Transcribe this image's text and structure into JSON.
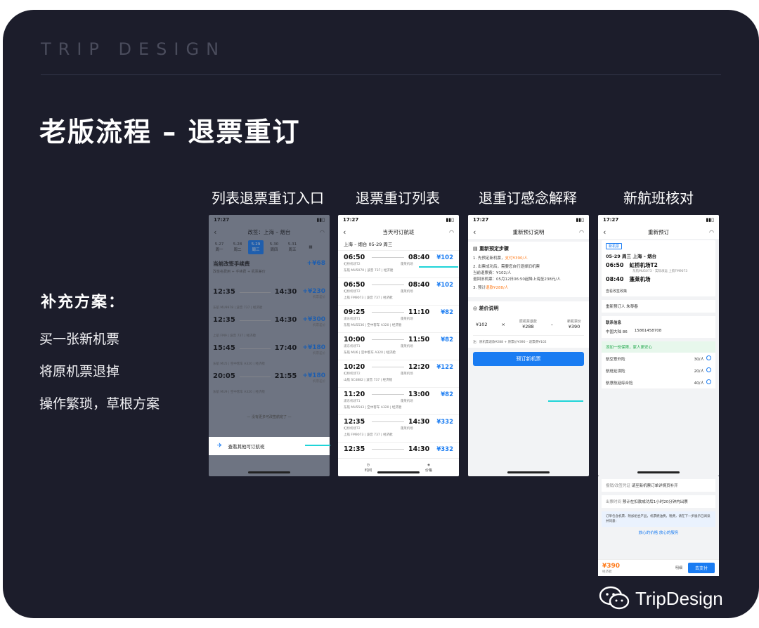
{
  "brand": "TRIP DESIGN",
  "title": "老版流程 – 退票重订",
  "supplement": {
    "title": "补充方案：",
    "items": [
      "买一张新机票",
      "将原机票退掉",
      "操作繁琐，草根方案"
    ]
  },
  "columns": [
    "列表退票重订入口",
    "退票重订列表",
    "退重订感念解释",
    "新航班核对"
  ],
  "status_time": "17:27",
  "phone1": {
    "nav_title": "改签：上海 – 烟台",
    "dates": [
      {
        "d": "5-27",
        "w": "周一"
      },
      {
        "d": "5-28",
        "w": "周二"
      },
      {
        "d": "5-29",
        "w": "周三"
      },
      {
        "d": "5-30",
        "w": "周四"
      },
      {
        "d": "5-31",
        "w": "周五"
      }
    ],
    "fee_title": "当前改签手续费",
    "fee_price": "+¥68",
    "fee_sub": "改签名费用 + 手续费 + 机票差价",
    "flights": [
      {
        "dep": "12:35",
        "arr": "14:30",
        "price": "+¥230",
        "note": "机票差价",
        "air": "东航 MU9978 | 波音 737 | 经济舱"
      },
      {
        "dep": "12:35",
        "arr": "14:30",
        "price": "+¥300",
        "note": "机票差价",
        "air": "上航 FM9 | 波音 737 | 经济舱"
      },
      {
        "dep": "15:45",
        "arr": "17:40",
        "price": "+¥180",
        "note": "机票差价",
        "air": "东航 MU5 | 空中客车 A320 | 经济舱"
      },
      {
        "dep": "20:05",
        "arr": "21:55",
        "price": "+¥180",
        "note": "机票差价",
        "air": "东航 MU9 | 空中客车 A320 | 经济舱"
      }
    ],
    "hint": "— 没有更多可改签航班了 —",
    "footer": "查看其他可订航班"
  },
  "phone2": {
    "nav_title": "当天可订航班",
    "route": "上海 – 烟台  05-29 周三",
    "flights": [
      {
        "dep": "06:50",
        "arr": "08:40",
        "price": "¥102",
        "from": "虹桥机场T2",
        "to": "蓬莱机场",
        "air": "东航 MU5070 | 波音 737 | 经济舱"
      },
      {
        "dep": "06:50",
        "arr": "08:40",
        "price": "¥102",
        "from": "虹桥机场T2",
        "to": "蓬莱机场",
        "air": "上航 FM9073 | 波音 737 | 经济舱"
      },
      {
        "dep": "09:25",
        "arr": "11:10",
        "price": "¥82",
        "from": "浦东机场T1",
        "to": "蓬莱机场",
        "air": "东航 MU5536 | 空中客车 A320 | 经济舱"
      },
      {
        "dep": "10:00",
        "arr": "11:50",
        "price": "¥82",
        "from": "浦东机场T1",
        "to": "蓬莱机场",
        "air": "东航 MU6 | 空中客车 A320 | 经济舱"
      },
      {
        "dep": "10:20",
        "arr": "12:20",
        "price": "¥122",
        "from": "虹桥机场T2",
        "to": "蓬莱机场",
        "air": "山航 SC4882 | 波音 737 | 经济舱"
      },
      {
        "dep": "11:20",
        "arr": "13:00",
        "price": "¥82",
        "from": "浦东机场T1",
        "to": "蓬莱机场",
        "air": "东航 MU5543 | 空中客车 A320 | 经济舱"
      },
      {
        "dep": "12:35",
        "arr": "14:30",
        "price": "¥332",
        "from": "虹桥机场T2",
        "to": "蓬莱机场",
        "air": "上航 FM9073 | 波音 737 | 经济舱"
      },
      {
        "dep": "12:35",
        "arr": "14:30",
        "price": "¥332",
        "from": "虹桥机场T2",
        "to": "蓬莱机场",
        "air": ""
      }
    ],
    "tab_left": "时间",
    "tab_right": "价格"
  },
  "phone3": {
    "nav_title": "重新预订说明",
    "steps_title": "重新预定步骤",
    "step1": "1. 先预定新机票，",
    "step1_hl": "支付¥390/人",
    "step2": "2. 出票成功后，需要您自行退掉旧机票",
    "step2b": "当前退票费：¥102/人",
    "step2c": "退回旧机票：05月12日06:50起降上海至238元/人",
    "step3": "3. 预计",
    "step3_hl": "退款¥288/人",
    "diff_title": "差价说明",
    "calc_a": "¥102",
    "calc_b_label": "原机票退款",
    "calc_b": "¥288",
    "calc_c_label": "新机票价",
    "calc_c": "¥390",
    "note": "注：原机票退款¥288 + 原票价¥390 – 退票费¥102",
    "button": "预订新机票"
  },
  "phone4": {
    "nav_title": "重新预订",
    "tag": "新机票",
    "date": "05-29 周三  上海 – 烟台",
    "dep_time": "06:50",
    "dep_airport": "虹桥机场T2",
    "dep_flight": "东航MU5073 · 实际承运 上航FM9073",
    "arr_time": "08:40",
    "arr_airport": "蓬莱机场",
    "policy_link": "查看改签政策",
    "passenger_label": "重新预订人",
    "passenger": "朱琴春",
    "contact_title": "联系信息",
    "country": "中国大陆 86",
    "phone": "15861458708",
    "insurance_title": "添加一份保障，家人更安心",
    "insurances": [
      {
        "name": "航空意外险",
        "price": "30/人"
      },
      {
        "name": "航班延误险",
        "price": "20/人"
      },
      {
        "name": "航意航延综合险",
        "price": "40/人"
      }
    ],
    "info1_label": "报销/改签凭证",
    "info1": "请至新机票订单详情页补开",
    "info2_label": "出票时间",
    "info2": "预计在扣款成功后1小时20分钟内出票",
    "notice": "订单包含机票、附加组合产品，机票燃油费，税费，请在下一步展示已阅读并同意：",
    "assurance": "放心的价格 放心的服务",
    "total": "¥390",
    "total_sub": "经济舱",
    "detail": "明细",
    "pay": "去支付"
  },
  "watermark": "TripDesign"
}
